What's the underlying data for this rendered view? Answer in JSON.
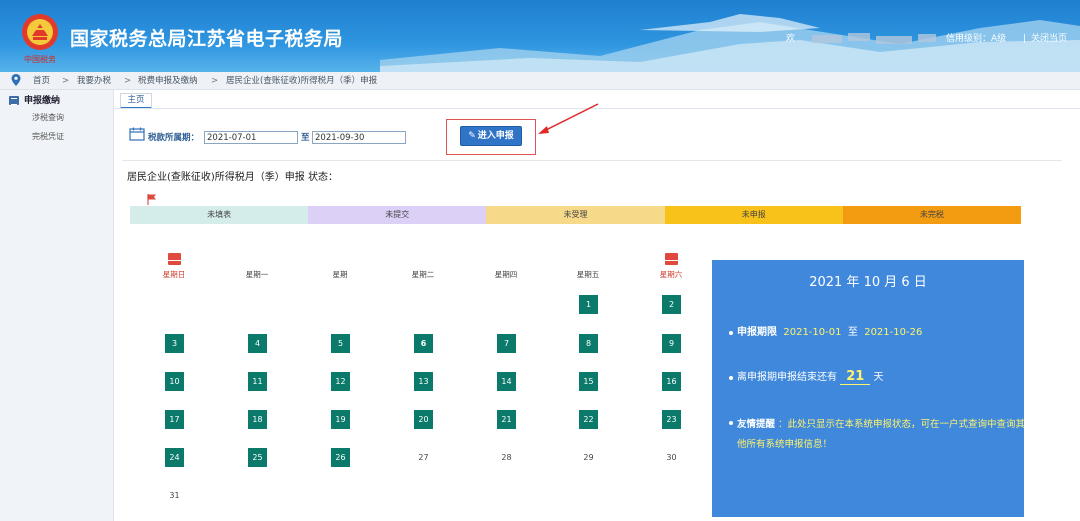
{
  "header": {
    "site_title": "国家税务总局江苏省电子税务局",
    "emblem_sub": "中国税务",
    "welcome": "欢",
    "credit_rating": "信用级别：A级",
    "separator": "|",
    "close_link": "关闭当页"
  },
  "breadcrumb": {
    "items": [
      "首页",
      "我要办税",
      "税费申报及缴纳",
      "居民企业(查账征收)所得税月（季）申报"
    ],
    "separator": ">"
  },
  "sidebar": {
    "heading": "申报缴纳",
    "items": [
      "涉税查询",
      "完税凭证"
    ]
  },
  "tab": {
    "label": "主页"
  },
  "filter": {
    "period_label": "税款所属期：",
    "start_date": "2021-07-01",
    "to_label": "至",
    "end_date": "2021-09-30",
    "enter_button": "进入申报"
  },
  "status": {
    "title": "居民企业(查账征收)所得税月（季）申报 状态：",
    "stages": [
      {
        "label": "未填表",
        "color": "#d4ecea"
      },
      {
        "label": "未提交",
        "color": "#dcd0f7"
      },
      {
        "label": "未受理",
        "color": "#f7d98a"
      },
      {
        "label": "未申报",
        "color": "#f9c21a"
      },
      {
        "label": "未完税",
        "color": "#f39c12"
      }
    ]
  },
  "calendar": {
    "weekdays": [
      "星期日",
      "星期一",
      "星期",
      "星期二",
      "星期四",
      "星期五",
      "星期六"
    ],
    "highlighted_days": [
      "1",
      "2",
      "3",
      "4",
      "5",
      "6",
      "7",
      "8",
      "9",
      "10",
      "11",
      "12",
      "13",
      "14",
      "15",
      "16",
      "17",
      "18",
      "19",
      "20",
      "21",
      "22",
      "23",
      "24",
      "25",
      "26"
    ],
    "plain_days": [
      "27",
      "28",
      "29",
      "30",
      "31"
    ]
  },
  "info": {
    "date": "2021 年 10 月 6 日",
    "deadline_label": "申报期限",
    "deadline_start": "2021-10-01",
    "deadline_to": "至",
    "deadline_end": "2021-10-26",
    "remaining_prefix": "离申报期申报结束还有",
    "remaining_days": "21",
    "remaining_suffix": "天",
    "note_label": "友情提醒",
    "note_text": "：此处只显示在本系统申报状态，可在一户式查询中查询其他所有系统申报信息！"
  },
  "colors": {
    "header_blue": "#2e95e0",
    "calendar_cell": "#0c7a6a",
    "info_panel": "#3f88dc",
    "highlight_yellow": "#fff36b"
  }
}
